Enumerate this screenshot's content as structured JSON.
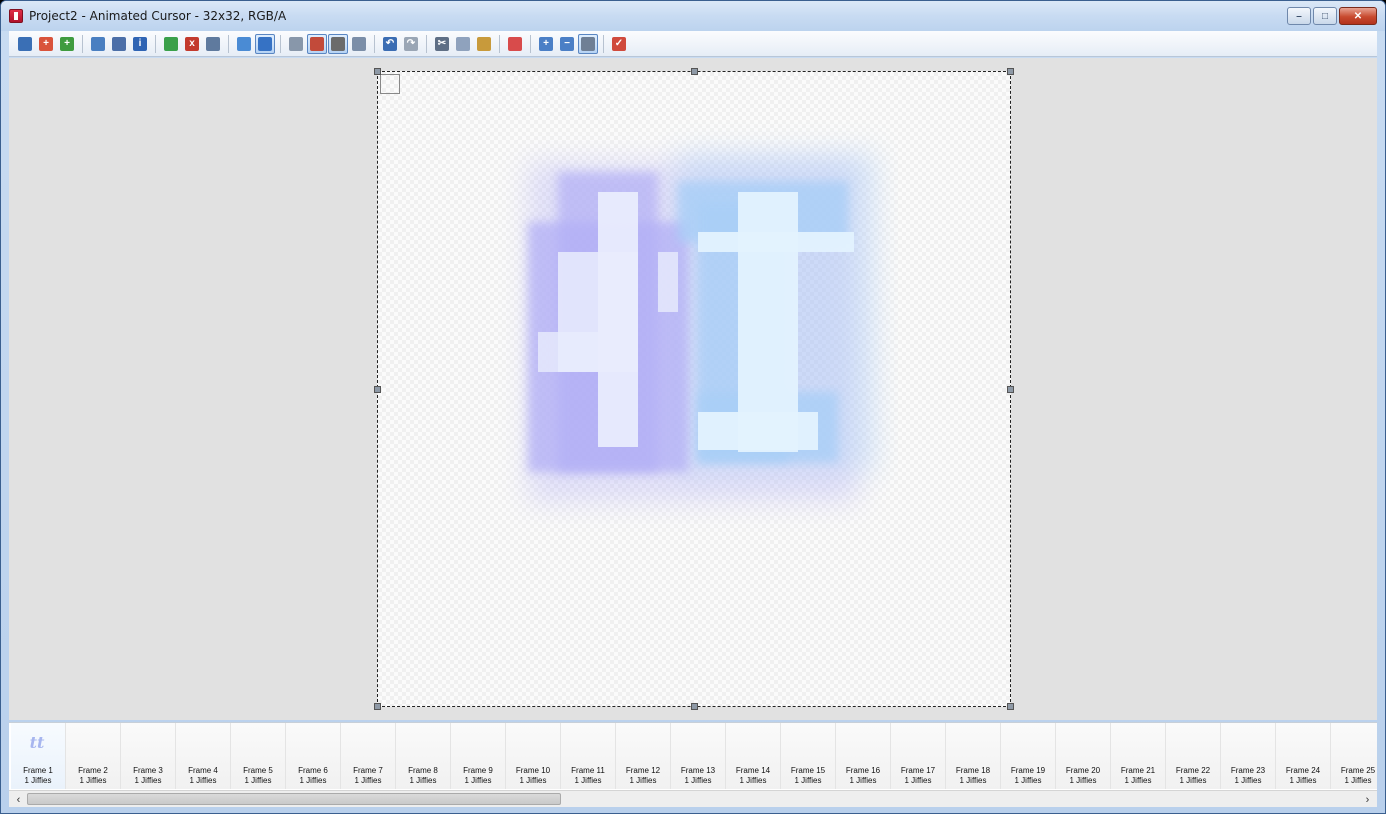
{
  "window": {
    "title": "Project2 - Animated Cursor - 32x32, RGB/A",
    "minimize": "–",
    "maximize": "□",
    "close": "✕"
  },
  "toolbar": {
    "buttons": [
      {
        "icon": "save-icon",
        "color": "#3a6fb5",
        "glyph": ""
      },
      {
        "icon": "new-image-icon",
        "color": "#d9533b",
        "glyph": "+"
      },
      {
        "icon": "new-frame-icon",
        "color": "#3f9b3f",
        "glyph": "+"
      },
      {
        "icon": "copy-frame-icon",
        "color": "#4a7fc1",
        "glyph": ""
      },
      {
        "icon": "image-properties-icon",
        "color": "#4c6fa8",
        "glyph": ""
      },
      {
        "icon": "info-icon",
        "color": "#2f64b4",
        "glyph": "i"
      },
      {
        "icon": "insert-frame-icon",
        "color": "#3aa04a",
        "glyph": ""
      },
      {
        "icon": "delete-frame-icon",
        "color": "#c33a2d",
        "glyph": "x"
      },
      {
        "icon": "timer-icon",
        "color": "#5f7a9e",
        "glyph": ""
      },
      {
        "icon": "test-cursor-icon",
        "color": "#4a8bd4",
        "glyph": ""
      },
      {
        "icon": "hotspot-icon",
        "color": "#3672c4",
        "glyph": ""
      },
      {
        "icon": "grid-icon",
        "color": "#8897aa",
        "glyph": ""
      },
      {
        "icon": "background-icon",
        "color": "#c24a3a",
        "glyph": ""
      },
      {
        "icon": "transparency-icon",
        "color": "#6b6b6b",
        "glyph": ""
      },
      {
        "icon": "preview-icon",
        "color": "#7b8ea8",
        "glyph": ""
      },
      {
        "icon": "undo-icon",
        "color": "#3b6db3",
        "glyph": "↶"
      },
      {
        "icon": "redo-icon",
        "color": "#9aa6b5",
        "glyph": "↷"
      },
      {
        "icon": "cut-icon",
        "color": "#5f6f85",
        "glyph": "✂"
      },
      {
        "icon": "copy-icon",
        "color": "#8fa2bd",
        "glyph": ""
      },
      {
        "icon": "paste-icon",
        "color": "#c89a3b",
        "glyph": ""
      },
      {
        "icon": "palette-icon",
        "color": "#d84b4b",
        "glyph": ""
      },
      {
        "icon": "zoom-in-icon",
        "color": "#4b7fc6",
        "glyph": "+"
      },
      {
        "icon": "zoom-out-icon",
        "color": "#4b7fc6",
        "glyph": "−"
      },
      {
        "icon": "edit-tools-icon",
        "color": "#6f7f95",
        "glyph": ""
      },
      {
        "icon": "apply-icon",
        "color": "#d04a3c",
        "glyph": "✓"
      }
    ],
    "active": [
      "hotspot-icon",
      "background-icon",
      "transparency-icon",
      "edit-tools-icon"
    ],
    "separators_after": [
      "new-frame-icon",
      "info-icon",
      "timer-icon",
      "hotspot-icon",
      "preview-icon",
      "redo-icon",
      "paste-icon",
      "palette-icon",
      "edit-tools-icon"
    ]
  },
  "frames": [
    {
      "name": "Frame 1",
      "duration": "1 Jiffies",
      "thumb": "tt"
    },
    {
      "name": "Frame 2",
      "duration": "1 Jiffies"
    },
    {
      "name": "Frame 3",
      "duration": "1 Jiffies"
    },
    {
      "name": "Frame 4",
      "duration": "1 Jiffies"
    },
    {
      "name": "Frame 5",
      "duration": "1 Jiffies"
    },
    {
      "name": "Frame 6",
      "duration": "1 Jiffies"
    },
    {
      "name": "Frame 7",
      "duration": "1 Jiffies"
    },
    {
      "name": "Frame 8",
      "duration": "1 Jiffies"
    },
    {
      "name": "Frame 9",
      "duration": "1 Jiffies"
    },
    {
      "name": "Frame 10",
      "duration": "1 Jiffies"
    },
    {
      "name": "Frame 11",
      "duration": "1 Jiffies"
    },
    {
      "name": "Frame 12",
      "duration": "1 Jiffies"
    },
    {
      "name": "Frame 13",
      "duration": "1 Jiffies"
    },
    {
      "name": "Frame 14",
      "duration": "1 Jiffies"
    },
    {
      "name": "Frame 15",
      "duration": "1 Jiffies"
    },
    {
      "name": "Frame 16",
      "duration": "1 Jiffies"
    },
    {
      "name": "Frame 17",
      "duration": "1 Jiffies"
    },
    {
      "name": "Frame 18",
      "duration": "1 Jiffies"
    },
    {
      "name": "Frame 19",
      "duration": "1 Jiffies"
    },
    {
      "name": "Frame 20",
      "duration": "1 Jiffies"
    },
    {
      "name": "Frame 21",
      "duration": "1 Jiffies"
    },
    {
      "name": "Frame 22",
      "duration": "1 Jiffies"
    },
    {
      "name": "Frame 23",
      "duration": "1 Jiffies"
    },
    {
      "name": "Frame 24",
      "duration": "1 Jiffies"
    },
    {
      "name": "Frame 25",
      "duration": "1 Jiffies"
    }
  ],
  "scrollbar": {
    "left_arrow": "‹",
    "right_arrow": "›"
  },
  "colors": {
    "glyph_violet": "#b3b0f6",
    "glyph_blue": "#a9cff7",
    "glyph_core_light": "#e9ecfd",
    "glyph_core_blue": "#e3f2fe"
  }
}
